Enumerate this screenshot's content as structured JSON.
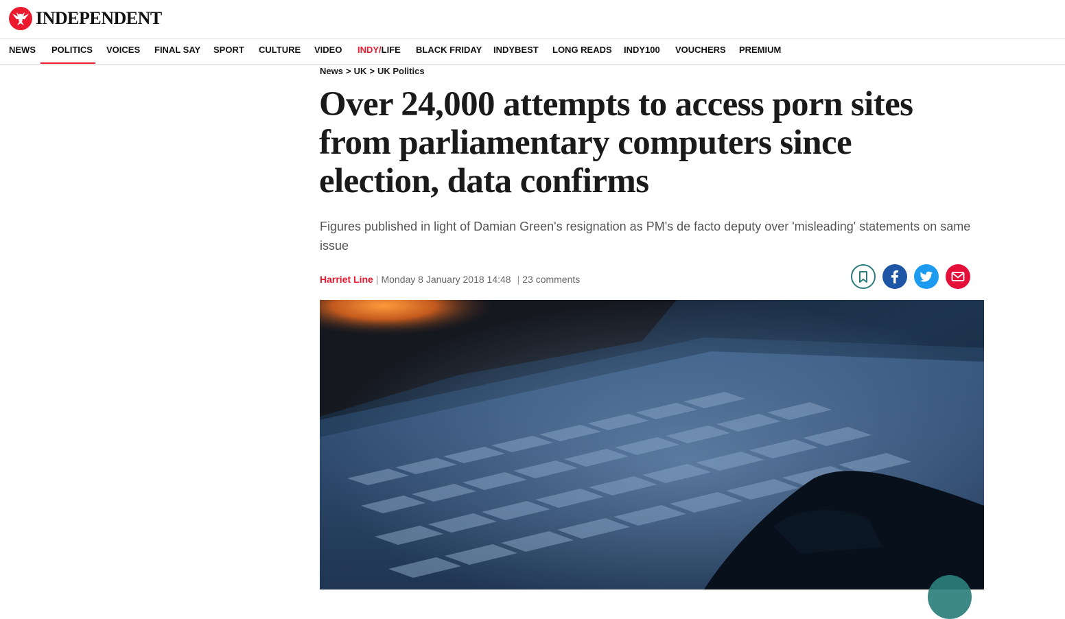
{
  "brand": {
    "name": "INDEPENDENT",
    "logo_icon": "eagle-icon",
    "accent_color": "#ec1a2e"
  },
  "nav": {
    "items": [
      {
        "label": "NEWS"
      },
      {
        "label": "POLITICS",
        "active": true
      },
      {
        "label": "VOICES"
      },
      {
        "label": "FINAL SAY"
      },
      {
        "label": "SPORT"
      },
      {
        "label": "CULTURE"
      },
      {
        "label": "VIDEO"
      },
      {
        "label_red": "INDY/",
        "label": "LIFE"
      },
      {
        "label": "BLACK FRIDAY"
      },
      {
        "label": "INDYBEST"
      },
      {
        "label": "LONG READS"
      },
      {
        "label": "INDY100"
      },
      {
        "label": "VOUCHERS"
      },
      {
        "label": "PREMIUM"
      }
    ]
  },
  "breadcrumb": {
    "items": [
      "News",
      "UK",
      "UK Politics"
    ],
    "separator": ">"
  },
  "article": {
    "headline": "Over 24,000 attempts to access porn sites from parliamentary computers since election, data confirms",
    "standfirst": "Figures published in light of Damian Green's resignation as PM's de facto deputy over 'misleading' statements on same issue",
    "author": "Harriet Line",
    "date": "Monday 8 January 2018 14:48",
    "comments": "23 comments",
    "separator": "|"
  },
  "share": {
    "icons": [
      "bookmark-icon",
      "facebook-icon",
      "twitter-icon",
      "email-icon"
    ],
    "colors": {
      "bookmark": "#2a7a7a",
      "facebook": "#1f55a5",
      "twitter": "#1d9bf0",
      "email": "#e4103a"
    }
  },
  "hero_image": {
    "subject": "laptop-keyboard-photo"
  }
}
